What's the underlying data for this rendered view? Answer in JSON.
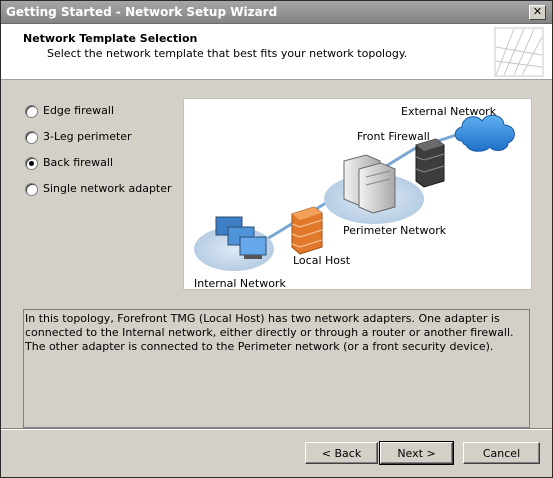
{
  "window": {
    "title": "Getting Started - Network Setup Wizard",
    "close_glyph": "✕"
  },
  "header": {
    "title": "Network Template Selection",
    "subtitle": "Select the network template that best fits your network topology."
  },
  "options": [
    {
      "label": "Edge firewall",
      "checked": false
    },
    {
      "label": "3-Leg perimeter",
      "checked": false
    },
    {
      "label": "Back firewall",
      "checked": true
    },
    {
      "label": "Single network adapter",
      "checked": false
    }
  ],
  "diagram": {
    "labels": {
      "external": "External Network",
      "front_firewall": "Front Firewall",
      "perimeter": "Perimeter Network",
      "local_host": "Local Host",
      "internal": "Internal Network"
    },
    "icons": [
      "monitors-icon",
      "firewall-brick-icon",
      "server-icon",
      "firewall-dark-icon",
      "cloud-icon"
    ]
  },
  "description": "In this topology, Forefront TMG (Local Host) has two network adapters. One adapter is connected to the Internal network, either directly or through a router or another firewall. The other adapter is connected to the Perimeter network (or a front security device).",
  "buttons": {
    "back": "< Back",
    "next": "Next >",
    "cancel": "Cancel"
  },
  "colors": {
    "accent_blue": "#1f78d1",
    "firewall_brick": "#e07a2a",
    "cloud": "#2a83d8"
  }
}
